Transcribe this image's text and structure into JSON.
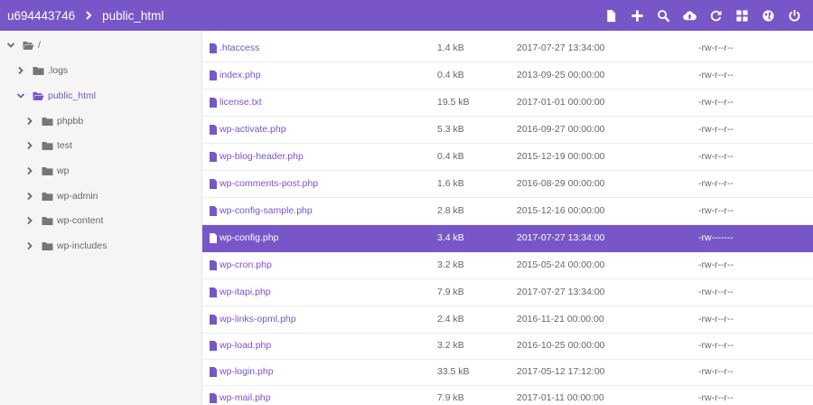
{
  "header": {
    "breadcrumb": [
      "u694443746",
      "public_html"
    ],
    "tools": [
      "new-file-icon",
      "add-icon",
      "search-icon",
      "upload-icon",
      "refresh-icon",
      "grid-view-icon",
      "globe-icon",
      "power-icon"
    ]
  },
  "sidebar": {
    "root": {
      "label": "/"
    },
    "items": [
      {
        "label": ".logs"
      },
      {
        "label": "public_html"
      },
      {
        "label": "phpbb"
      },
      {
        "label": "test"
      },
      {
        "label": "wp"
      },
      {
        "label": "wp-admin"
      },
      {
        "label": "wp-content"
      },
      {
        "label": "wp-includes"
      }
    ]
  },
  "files": [
    {
      "name": ".htaccess",
      "size": "1.4 kB",
      "date": "2017-07-27 13:34:00",
      "perm": "-rw-r--r--"
    },
    {
      "name": "index.php",
      "size": "0.4 kB",
      "date": "2013-09-25 00:00:00",
      "perm": "-rw-r--r--"
    },
    {
      "name": "license.txt",
      "size": "19.5 kB",
      "date": "2017-01-01 00:00:00",
      "perm": "-rw-r--r--"
    },
    {
      "name": "wp-activate.php",
      "size": "5.3 kB",
      "date": "2016-09-27 00:00:00",
      "perm": "-rw-r--r--"
    },
    {
      "name": "wp-blog-header.php",
      "size": "0.4 kB",
      "date": "2015-12-19 00:00:00",
      "perm": "-rw-r--r--"
    },
    {
      "name": "wp-comments-post.php",
      "size": "1.6 kB",
      "date": "2016-08-29 00:00:00",
      "perm": "-rw-r--r--"
    },
    {
      "name": "wp-config-sample.php",
      "size": "2.8 kB",
      "date": "2015-12-16 00:00:00",
      "perm": "-rw-r--r--"
    },
    {
      "name": "wp-config.php",
      "size": "3.4 kB",
      "date": "2017-07-27 13:34:00",
      "perm": "-rw-------"
    },
    {
      "name": "wp-cron.php",
      "size": "3.2 kB",
      "date": "2015-05-24 00:00:00",
      "perm": "-rw-r--r--"
    },
    {
      "name": "wp-itapi.php",
      "size": "7.9 kB",
      "date": "2017-07-27 13:34:00",
      "perm": "-rw-r--r--"
    },
    {
      "name": "wp-links-opml.php",
      "size": "2.4 kB",
      "date": "2016-11-21 00:00:00",
      "perm": "-rw-r--r--"
    },
    {
      "name": "wp-load.php",
      "size": "3.2 kB",
      "date": "2016-10-25 00:00:00",
      "perm": "-rw-r--r--"
    },
    {
      "name": "wp-login.php",
      "size": "33.5 kB",
      "date": "2017-05-12 17:12:00",
      "perm": "-rw-r--r--"
    },
    {
      "name": "wp-mail.php",
      "size": "7.9 kB",
      "date": "2017-01-11 00:00:00",
      "perm": "-rw-r--r--"
    }
  ],
  "selected_file": "wp-config.php",
  "colors": {
    "accent": "#7856c8",
    "sidebar_bg": "#f5f5f5",
    "link": "#7a52cc"
  }
}
